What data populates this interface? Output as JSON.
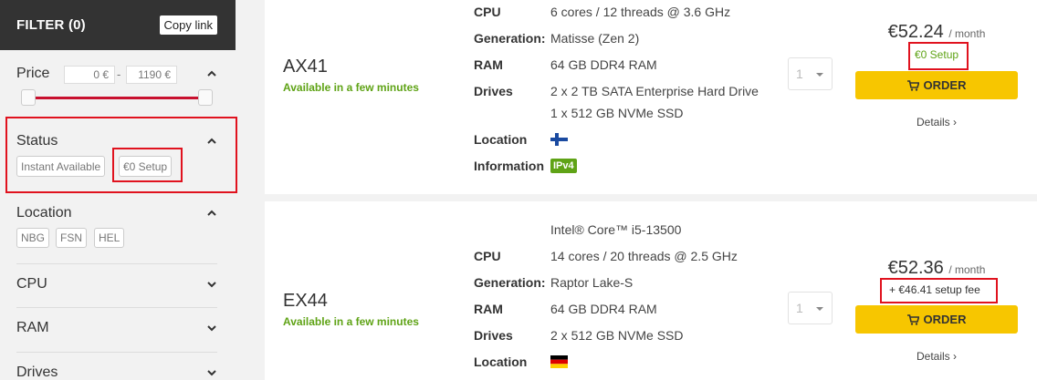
{
  "filter": {
    "title": "FILTER (0)",
    "copy_link": "Copy link",
    "price": {
      "label": "Price",
      "min_value": "0 €",
      "separator": "-",
      "max_value": "1190 €"
    },
    "status": {
      "label": "Status",
      "tags": [
        "Instant Available",
        "€0 Setup"
      ]
    },
    "location": {
      "label": "Location",
      "tags": [
        "NBG",
        "FSN",
        "HEL"
      ]
    },
    "cpu": {
      "label": "CPU"
    },
    "ram": {
      "label": "RAM"
    },
    "drives": {
      "label": "Drives"
    }
  },
  "servers": [
    {
      "name": "AX41",
      "availability": "Available in a few minutes",
      "specs": {
        "cpu_label": "CPU",
        "cpu": "6 cores / 12 threads @ 3.6 GHz",
        "generation_label": "Generation:",
        "generation": "Matisse (Zen 2)",
        "ram_label": "RAM",
        "ram": "64 GB DDR4 RAM",
        "drives_label": "Drives",
        "drive1": "2 x 2 TB SATA Enterprise Hard Drive",
        "drive2": "1 x 512 GB NVMe SSD",
        "location_label": "Location",
        "location_flag": "finland-flag",
        "information_label": "Information",
        "information_badge": "IPv4"
      },
      "quantity": "1",
      "price": "€52.24",
      "per": "/ month",
      "setup": "€0 Setup",
      "order_label": "ORDER",
      "details_label": "Details"
    },
    {
      "name": "EX44",
      "availability": "Available in a few minutes",
      "specs": {
        "processor": "Intel® Core™ i5-13500",
        "cpu_label": "CPU",
        "cpu": "14 cores / 20 threads @ 2.5 GHz",
        "generation_label": "Generation:",
        "generation": "Raptor Lake-S",
        "ram_label": "RAM",
        "ram": "64 GB DDR4 RAM",
        "drives_label": "Drives",
        "drive1": "2 x 512 GB NVMe SSD",
        "location_label": "Location",
        "location_flag": "germany-flag"
      },
      "quantity": "1",
      "price": "€52.36",
      "per": "/ month",
      "setup": "+ €46.41 setup fee",
      "order_label": "ORDER",
      "details_label": "Details"
    }
  ],
  "colors": {
    "header_bg": "#333333",
    "accent_red": "#c8102e",
    "available_green": "#5fa316",
    "order_yellow": "#f7c600",
    "highlight_red": "#e0121e"
  }
}
